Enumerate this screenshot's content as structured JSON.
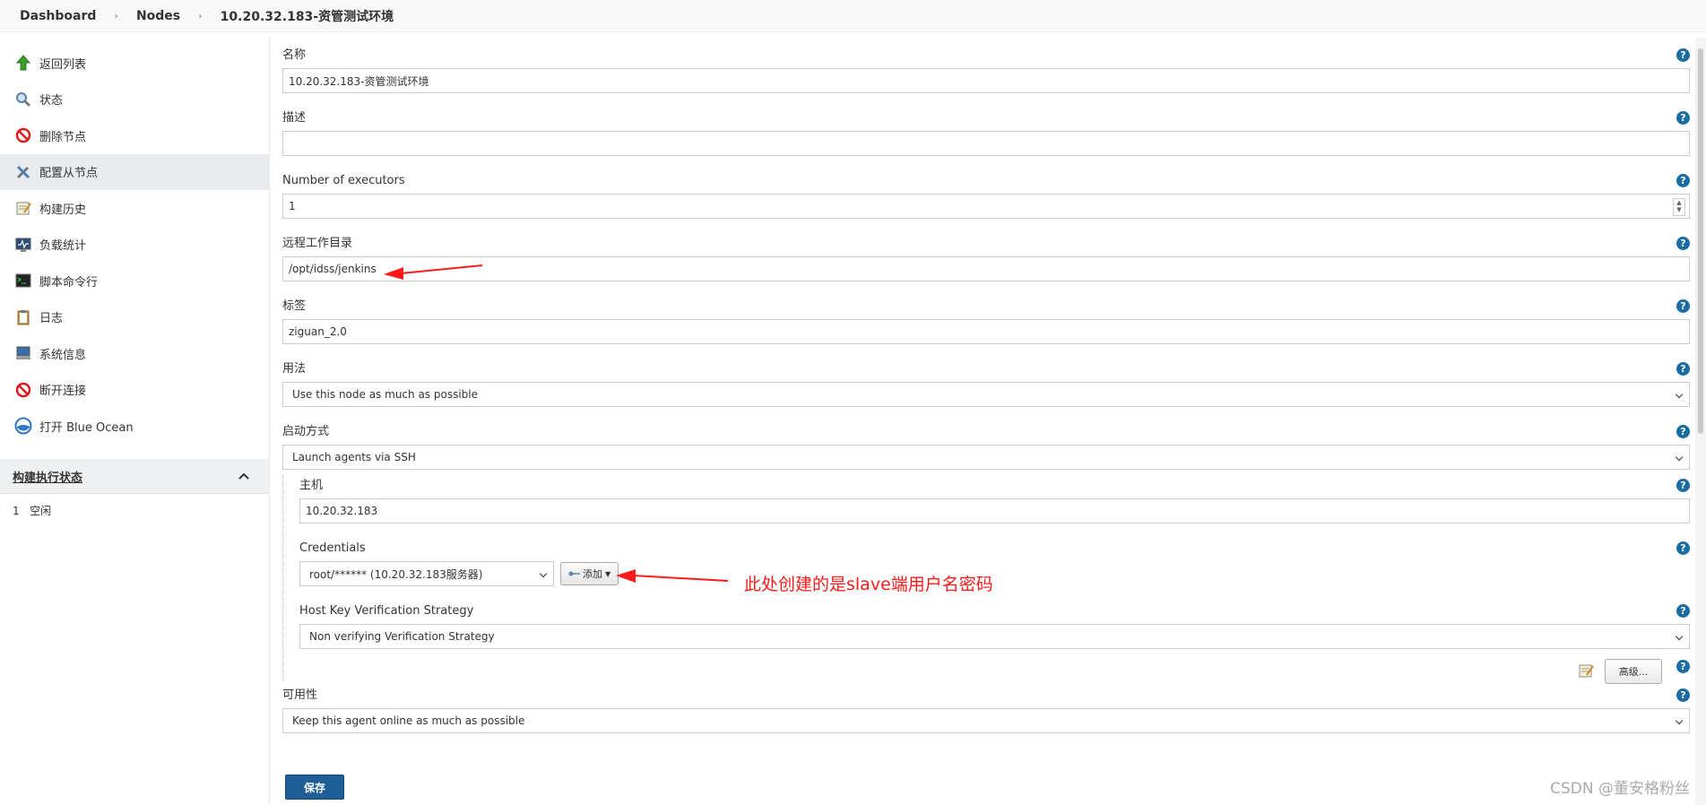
{
  "breadcrumb": [
    "Dashboard",
    "Nodes",
    "10.20.32.183-资管测试环境"
  ],
  "sidebar": {
    "items": [
      {
        "label": "返回列表",
        "icon": "up-arrow-icon"
      },
      {
        "label": "状态",
        "icon": "search-icon"
      },
      {
        "label": "删除节点",
        "icon": "no-entry-icon"
      },
      {
        "label": "配置从节点",
        "icon": "tools-icon"
      },
      {
        "label": "构建历史",
        "icon": "notepad-icon"
      },
      {
        "label": "负载统计",
        "icon": "monitor-icon"
      },
      {
        "label": "脚本命令行",
        "icon": "terminal-icon"
      },
      {
        "label": "日志",
        "icon": "clipboard-icon"
      },
      {
        "label": "系统信息",
        "icon": "computer-icon"
      },
      {
        "label": "断开连接",
        "icon": "no-entry-icon"
      },
      {
        "label": "打开 Blue Ocean",
        "icon": "blue-ocean-icon"
      }
    ],
    "active_index": 3
  },
  "executor_panel": {
    "title": "构建执行状态",
    "rows": [
      {
        "num": "1",
        "status": "空闲"
      }
    ]
  },
  "form": {
    "name": {
      "label": "名称",
      "value": "10.20.32.183-资管测试环境"
    },
    "description": {
      "label": "描述",
      "value": ""
    },
    "executors": {
      "label": "Number of executors",
      "value": "1"
    },
    "remote_dir": {
      "label": "远程工作目录",
      "value": "/opt/idss/jenkins"
    },
    "labels": {
      "label": "标签",
      "value": "ziguan_2.0"
    },
    "usage": {
      "label": "用法",
      "value": "Use this node as much as possible"
    },
    "launch": {
      "label": "启动方式",
      "value": "Launch agents via SSH"
    },
    "host": {
      "label": "主机",
      "value": "10.20.32.183"
    },
    "credentials": {
      "label": "Credentials",
      "value": "root/****** (10.20.32.183服务器)",
      "add_label": "添加"
    },
    "host_key": {
      "label": "Host Key Verification Strategy",
      "value": "Non verifying Verification Strategy"
    },
    "advanced_label": "高级...",
    "availability": {
      "label": "可用性",
      "value": "Keep this agent online as much as possible"
    },
    "save_label": "保存"
  },
  "annotation": {
    "text": "此处创建的是slave端用户名密码",
    "color": "#ff1a1a"
  },
  "watermark": "CSDN @董安格粉丝"
}
